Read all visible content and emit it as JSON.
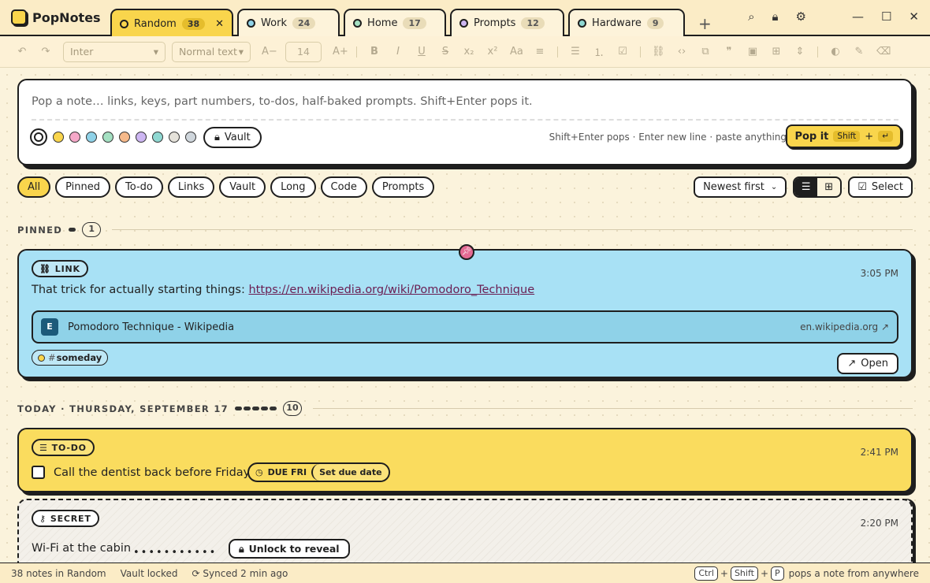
{
  "app": {
    "name": "PopNotes"
  },
  "tabs": [
    {
      "label": "Random",
      "count": "38",
      "color": "#f9d54c",
      "active": true
    },
    {
      "label": "Work",
      "count": "24",
      "color": "#8fd2e8"
    },
    {
      "label": "Home",
      "count": "17",
      "color": "#a4e0c2"
    },
    {
      "label": "Prompts",
      "count": "12",
      "color": "#cdb6f2"
    },
    {
      "label": "Hardware",
      "count": "9",
      "color": "#8fd8d2"
    }
  ],
  "toolbar": {
    "font": "Inter",
    "style": "Normal text",
    "size": "14",
    "decrease": "A−",
    "increase": "A+"
  },
  "composer": {
    "placeholder": "Pop a note… links, keys, part numbers, to-dos, half-baked prompts. Shift+Enter pops it.",
    "vault_label": "Vault",
    "hint": "Shift+Enter pops · Enter new line · paste anything",
    "pop_label": "Pop it",
    "pop_key1": "Shift",
    "pop_plus": "+",
    "pop_key2": "↵",
    "colors": [
      "#ffffff",
      "#f9d54c",
      "#f5a8c8",
      "#8fd2e8",
      "#a4e0c2",
      "#f6b98a",
      "#cdb6f2",
      "#8fd8d2",
      "#e5e2da",
      "#cfd6dc"
    ]
  },
  "filters": [
    "All",
    "Pinned",
    "To-do",
    "Links",
    "Vault",
    "Long",
    "Code",
    "Prompts"
  ],
  "sort": {
    "label": "Newest first",
    "select_label": "Select"
  },
  "sections": {
    "pinned": {
      "label": "PINNED",
      "count": "1"
    },
    "today": {
      "label": "TODAY · THURSDAY, SEPTEMBER 17",
      "count": "10"
    }
  },
  "notes": {
    "link": {
      "tag": "LINK",
      "time": "3:05 PM",
      "text": "That trick for actually starting things: ",
      "url": "https://en.wikipedia.org/wiki/Pomodoro_Technique",
      "preview_icon": "E",
      "preview_title": "Pomodoro Technique - Wikipedia",
      "preview_domain": "en.wikipedia.org",
      "hashtag_symbol": "#",
      "hashtag": "someday",
      "open_label": "Open"
    },
    "todo": {
      "tag": "TO-DO",
      "time": "2:41 PM",
      "text": "Call the dentist back before Friday",
      "due": "DUE FRI",
      "set_due": "Set due date"
    },
    "secret": {
      "tag": "SECRET",
      "time": "2:20 PM",
      "text": "Wi-Fi at the cabin",
      "dots": "•••••••••••",
      "unlock_label": "Unlock to reveal"
    }
  },
  "status": {
    "count": "38 notes in Random",
    "vault": "Vault locked",
    "sync": "Synced 2 min ago",
    "key1": "Ctrl",
    "key2": "Shift",
    "key3": "P",
    "plus": "+",
    "shortcut_text": "pops a note from anywhere"
  }
}
